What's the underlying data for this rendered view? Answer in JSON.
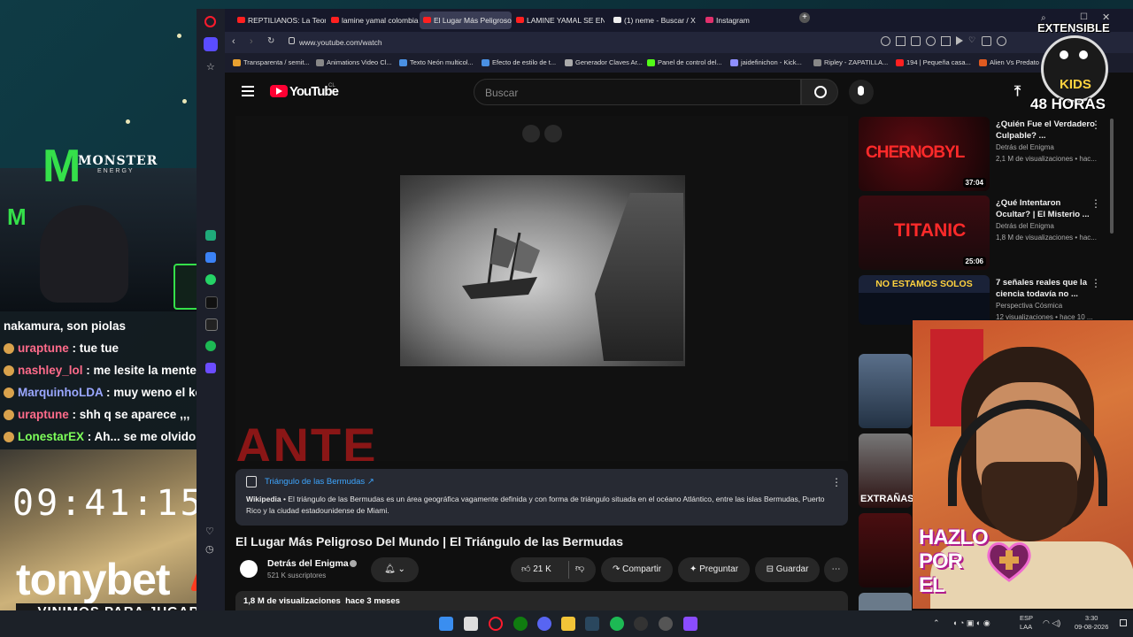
{
  "browser": {
    "tabs": [
      {
        "label": "REPTILIANOS: La Teoría C",
        "active": false
      },
      {
        "label": "lamine yamal colombia -",
        "active": false
      },
      {
        "label": "El Lugar Más Peligroso De",
        "active": true
      },
      {
        "label": "LAMINE YAMAL SE ENAM",
        "active": false
      },
      {
        "label": "(1) neme - Buscar / X",
        "active": false
      },
      {
        "label": "Instagram",
        "active": false
      }
    ],
    "url": "www.youtube.com/watch",
    "bookmarks": [
      "Transparenta / semit...",
      "Animations Video Cl...",
      "Texto Neón multicol...",
      "Efecto de estilo de t...",
      "Generador Claves Ar...",
      "Panel de control del...",
      "jaidefinichon - Kick...",
      "Ripley - ZAPATILLA...",
      "194 | Pequeña casa...",
      "Alien Vs Predato"
    ]
  },
  "youtube": {
    "logo": "YouTube",
    "country_code": "CL",
    "search_placeholder": "Buscar",
    "video_title": "El Lugar Más Peligroso Del Mundo | El Triángulo de las Bermudas",
    "overlay_text": "ANTE",
    "info_panel": {
      "title": "Triángulo de las Bermudas ↗",
      "source": "Wikipedia",
      "text": " • El triángulo de las Bermudas es un área geográfica vagamente definida y con forma de triángulo situada en el océano Atlántico, entre las islas Bermudas, Puerto Rico y la ciudad estadounidense de Miami."
    },
    "channel": {
      "name": "Detrás del Enigma",
      "subscribers": "521 K suscriptores"
    },
    "actions": {
      "likes": "21 K",
      "share": "Compartir",
      "ask": "Preguntar",
      "save": "Guardar"
    },
    "description": {
      "views": "1,8 M de visualizaciones",
      "date": "hace 3 meses"
    },
    "recommendations": [
      {
        "title": "¿Quién Fue el Verdadero Culpable? ...",
        "channel": "Detrás del Enigma",
        "meta": "2,1 M de visualizaciones • hac...",
        "duration": "37:04",
        "thumb_text": "CHERNOBYL"
      },
      {
        "title": "¿Qué Intentaron Ocultar? | El Misterio ...",
        "channel": "Detrás del Enigma",
        "meta": "1,8 M de visualizaciones • hac...",
        "duration": "25:06",
        "thumb_text": "TITANIC"
      },
      {
        "title": "7 señales reales que la ciencia todavía no ...",
        "channel": "Perspectiva Cósmica",
        "meta": "12 visualizaciones • hace 10 ...",
        "duration": "",
        "thumb_text": "NO ESTAMOS SOLOS"
      },
      {
        "title": "",
        "channel": "",
        "meta": "",
        "duration": "",
        "thumb_text": ""
      },
      {
        "title": "",
        "channel": "",
        "meta": "",
        "duration": "",
        "thumb_text": "EXTRAÑAS D"
      },
      {
        "title": "",
        "channel": "",
        "meta": "",
        "duration": "",
        "thumb_text": ""
      }
    ]
  },
  "stream_overlay": {
    "chat": [
      {
        "user": "",
        "message": "nakamura, son piolas",
        "color": "#ffffff"
      },
      {
        "user": "uraptune",
        "message": " : tue tue",
        "color": "#ff6b8a"
      },
      {
        "user": "nashley_lol",
        "message": " : me lesite la mente",
        "color": "#ff6b8a"
      },
      {
        "user": "MarquinhoLDA",
        "message": " : muy weno el kenji",
        "color": "#9aa7ff"
      },
      {
        "user": "uraptune",
        "message": " : shh q se aparece ,,,",
        "color": "#ff6b8a"
      },
      {
        "user": "LonestarEX",
        "message": " : Ah... se me olvido",
        "color": "#7dff5a"
      }
    ],
    "timer": "09:41:15",
    "sponsor": "tonybet",
    "sponsor_slogan": "VINIMOS PARA JUGAR",
    "monster_brand": "MONSTER",
    "monster_sub": "ENERGY",
    "badge_top": "EXTENSIBLE",
    "badge_mid": "KIDS",
    "badge_bottom": "48 HORAS",
    "avatar_text": [
      "HAZLO",
      "POR",
      "EL"
    ]
  },
  "taskbar": {
    "lang": "ESP",
    "region": "LAA",
    "time": "3:30",
    "date": "09-08-2026"
  },
  "colors": {
    "youtube_red": "#ff0033",
    "accent_blue": "#3ea6ff",
    "avatar_bg": "#c8522a"
  }
}
